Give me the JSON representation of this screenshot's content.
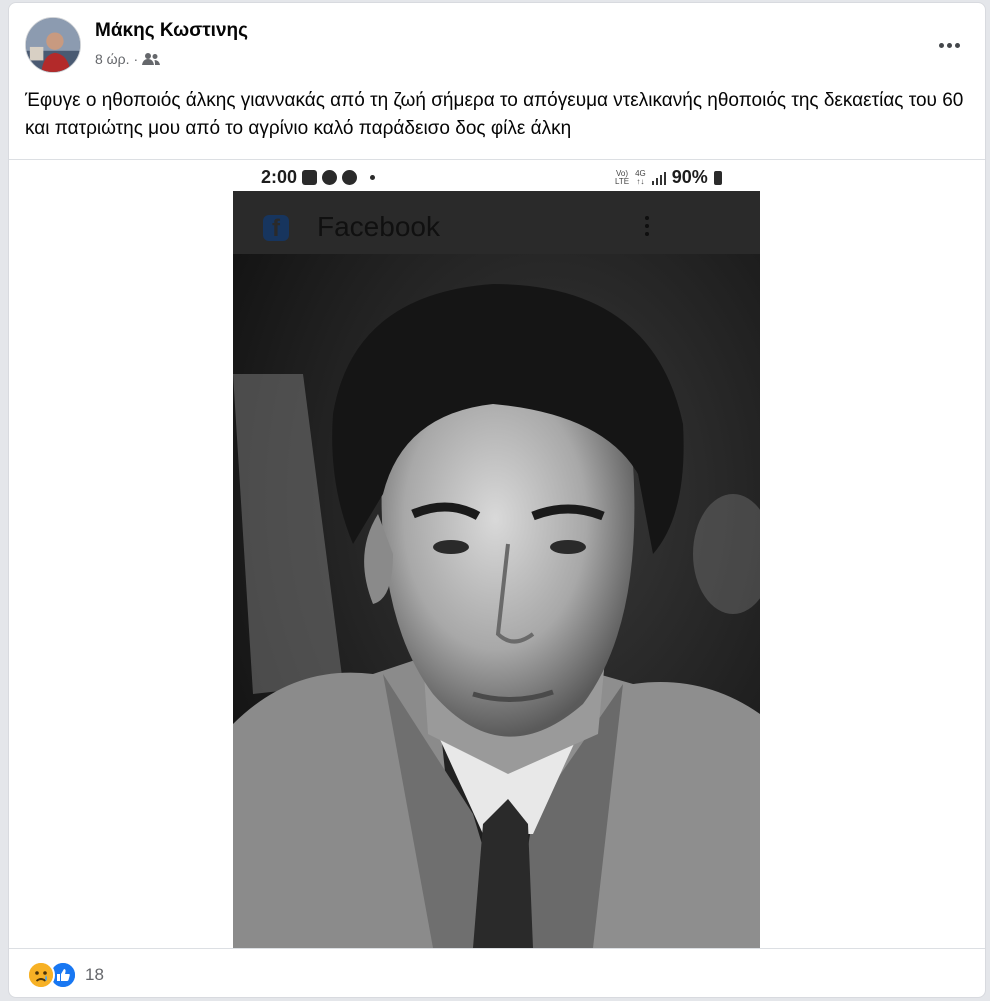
{
  "post": {
    "author": "Μάκης Κωστινης",
    "time": "8 ώρ.",
    "separator": "·",
    "audience_icon": "friends-icon",
    "more_icon": "more-options-icon",
    "text": "Έφυγε ο ηθοποιός άλκης γιαννακάς από τη ζωή σήμερα το απόγευμα ντελικανής ηθοποιός της δεκαετίας του 60 και πατριώτης μου από το αγρίνιο καλό παράδεισο δος φίλε άλκη"
  },
  "screenshot": {
    "status_time": "2:00",
    "status_network_top": "Vo)",
    "status_network_bottom": "LTE",
    "status_gen_top": "4G",
    "status_gen_bottom": "↑↓",
    "status_battery": "90%",
    "app_title": "Facebook",
    "app_logo": "f"
  },
  "reactions": {
    "icons": [
      "sad-reaction-icon",
      "like-reaction-icon"
    ],
    "count": "18"
  },
  "colors": {
    "link_blue": "#1877f2",
    "secondary_text": "#65676b",
    "sad_yellow": "#f7b125"
  }
}
